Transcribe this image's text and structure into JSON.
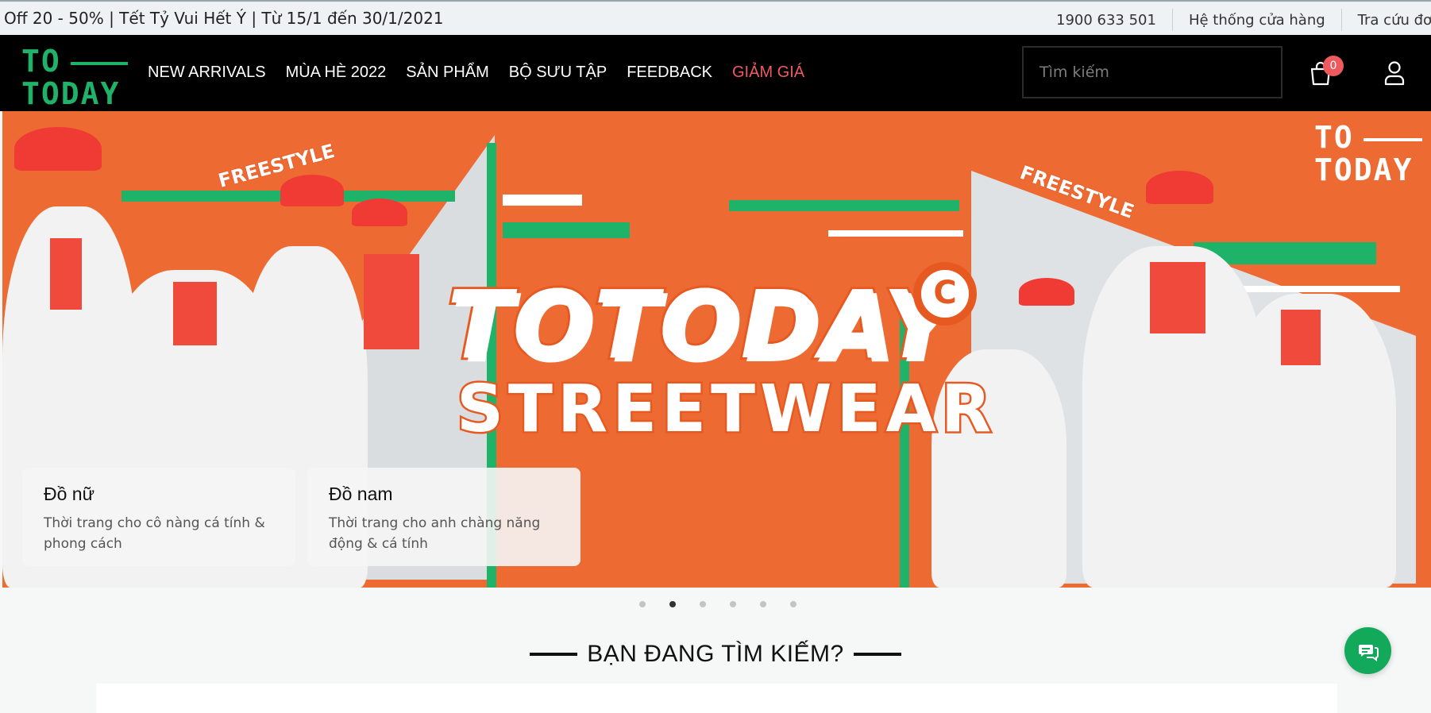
{
  "topbar": {
    "promo": "Off 20 - 50% | Tết Tỷ Vui Hết Ý | Từ 15/1 đến 30/1/2021",
    "phone": "1900 633 501",
    "stores": "Hệ thống cửa hàng",
    "order_lookup": "Tra cứu đơn"
  },
  "header": {
    "logo_line1": "TO",
    "logo_line2": "TODAY",
    "nav": [
      "NEW ARRIVALS",
      "MÙA HÈ 2022",
      "SẢN PHẨM",
      "BỘ SƯU TẬP",
      "FEEDBACK",
      "GIẢM GIÁ"
    ],
    "search_placeholder": "Tìm kiếm",
    "cart_count": "0",
    "icons": {
      "cart": "shopping-bag-icon",
      "user": "user-icon"
    }
  },
  "hero": {
    "brand": "TOTODAY",
    "brand_mark": "C",
    "tagline": "STREETWEAR",
    "sticker": "FREESTYLE",
    "logo_line1": "TO",
    "logo_line2": "TODAY",
    "cards": [
      {
        "title": "Đồ nữ",
        "desc": "Thời trang cho cô nàng cá tính & phong cách"
      },
      {
        "title": "Đồ nam",
        "desc": "Thời trang cho anh chàng năng động & cá tính"
      }
    ],
    "slides": 6,
    "active_slide": 2
  },
  "section": {
    "title": "BẠN ĐANG TÌM KIẾM?"
  },
  "colors": {
    "brand_green": "#1fb36a",
    "sale_red": "#ef5a5f",
    "hero_orange": "#ee6a33",
    "chat_green": "#12a95b"
  },
  "chat_icon": "chat-icon"
}
